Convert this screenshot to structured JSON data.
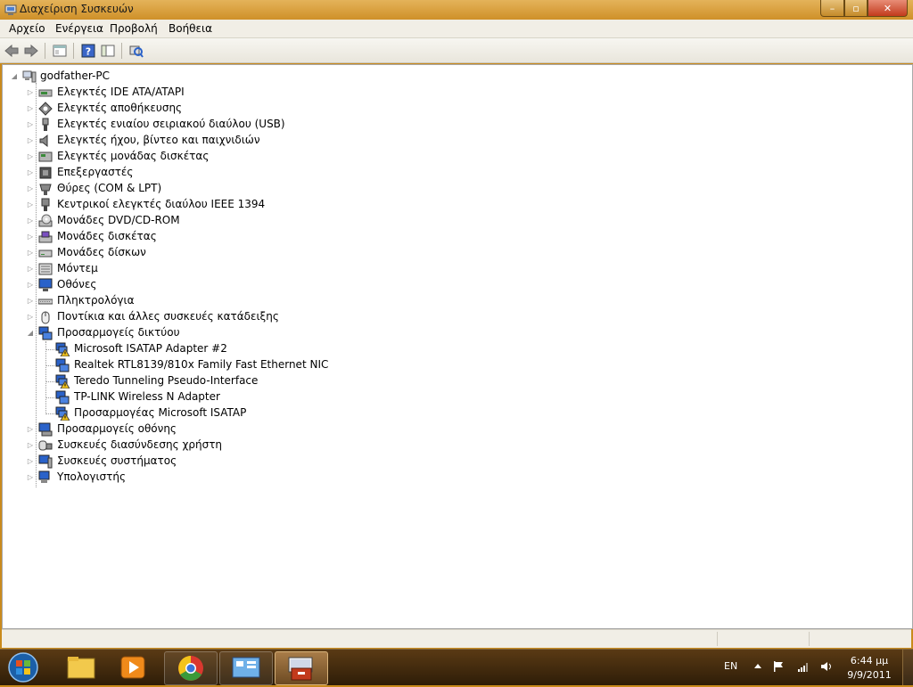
{
  "window": {
    "title": "Διαχείριση Συσκευών",
    "controls": {
      "minimize": "–",
      "maximize": "▫",
      "close": "✕"
    }
  },
  "menu": [
    "Αρχείο",
    "Ενέργεια",
    "Προβολή",
    "Βοήθεια"
  ],
  "toolbar": {
    "icons": [
      "back-arrow-icon",
      "forward-arrow-icon",
      "properties-icon",
      "help-icon",
      "console-tree-icon",
      "scan-hardware-icon"
    ]
  },
  "tree": {
    "root": "godfather-PC",
    "categories": [
      "Ελεγκτές IDE ATA/ATAPI",
      "Ελεγκτές αποθήκευσης",
      "Ελεγκτές ενιαίου σειριακού διαύλου (USB)",
      "Ελεγκτές ήχου, βίντεο και παιχνιδιών",
      "Ελεγκτές μονάδας δισκέτας",
      "Επεξεργαστές",
      "Θύρες (COM & LPT)",
      "Κεντρικοί ελεγκτές διαύλου IEEE 1394",
      "Μονάδες DVD/CD-ROM",
      "Μονάδες δισκέτας",
      "Μονάδες δίσκων",
      "Μόντεμ",
      "Οθόνες",
      "Πληκτρολόγια",
      "Ποντίκια και άλλες συσκευές κατάδειξης",
      "Προσαρμογείς δικτύου"
    ],
    "expanded_children": [
      {
        "label": "Microsoft ISATAP Adapter #2",
        "warning": true
      },
      {
        "label": "Realtek RTL8139/810x Family Fast Ethernet NIC",
        "warning": false
      },
      {
        "label": "Teredo Tunneling Pseudo-Interface",
        "warning": true
      },
      {
        "label": "TP-LINK Wireless N Adapter",
        "warning": false
      },
      {
        "label": "Προσαρμογέας Microsoft ISATAP",
        "warning": true
      }
    ],
    "categories_after": [
      "Προσαρμογείς οθόνης",
      "Συσκευές διασύνδεσης χρήστη",
      "Συσκευές συστήματος",
      "Υπολογιστής"
    ],
    "expander_collapsed": "▷",
    "expander_expanded": "◢"
  },
  "taskbar": {
    "items": [
      "start-orb",
      "windows-explorer",
      "media-player",
      "chrome",
      "control-panel",
      "device-manager"
    ],
    "language": "EN",
    "time": "6:44 μμ",
    "date": "9/9/2011"
  },
  "colors": {
    "title_bar": "#cf9028",
    "taskbar": "#3a2510",
    "warning": "#f2c31a",
    "network_blue": "#2a62c9"
  }
}
